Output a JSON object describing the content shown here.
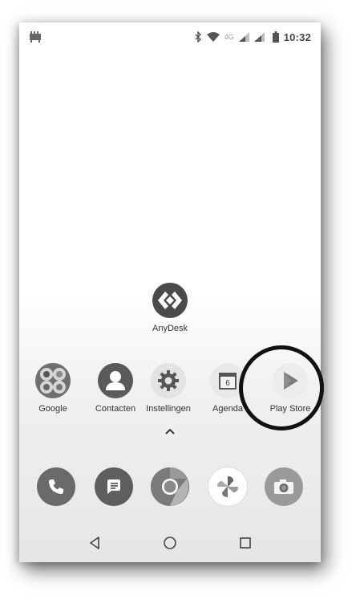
{
  "statusbar": {
    "network_type": "4G",
    "time": "10:32",
    "icons": [
      "notification-app-icon",
      "bluetooth-icon",
      "wifi-icon",
      "signal-icon",
      "signal-icon",
      "battery-icon"
    ]
  },
  "apps": {
    "anydesk": {
      "label": "AnyDesk",
      "icon": "anydesk-icon"
    },
    "row": [
      {
        "label": "Google",
        "icon": "google-folder-icon"
      },
      {
        "label": "Contacten",
        "icon": "contacts-icon"
      },
      {
        "label": "Instellingen",
        "icon": "settings-icon"
      },
      {
        "label": "Agenda",
        "icon": "calendar-icon",
        "calendar_day": "6"
      },
      {
        "label": "Play Store",
        "icon": "play-store-icon"
      }
    ]
  },
  "hotseat": [
    "phone-icon",
    "messages-icon",
    "chrome-icon",
    "photos-icon",
    "camera-icon"
  ],
  "navbar": [
    "back-icon",
    "home-icon",
    "recents-icon"
  ],
  "colors": {
    "icon_dark": "#4a4a4a",
    "icon_mid": "#7a7a7a",
    "highlight": "#111111"
  }
}
